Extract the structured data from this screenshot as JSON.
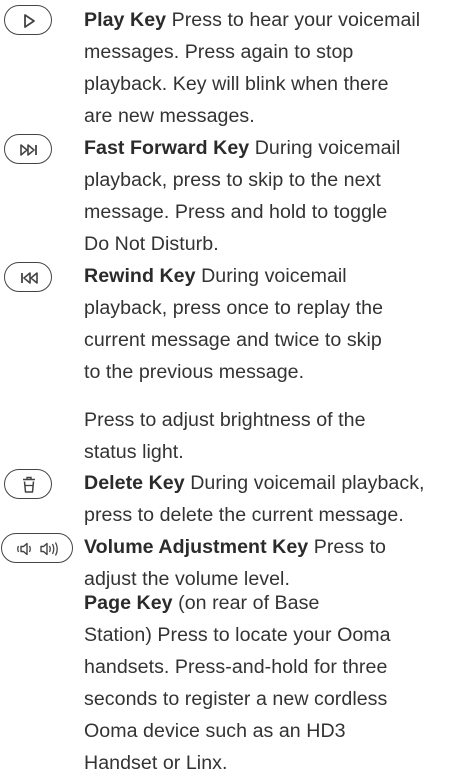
{
  "entries": [
    {
      "icon": "play-icon",
      "title": "Play Key",
      "lines": [
        "Press to hear your voicemail",
        "messages. Press again to stop",
        "playback. Key will blink when there",
        "are new messages."
      ]
    },
    {
      "icon": "fast-forward-icon",
      "title": "Fast Forward Key",
      "lines": [
        "During voicemail",
        "playback, press to skip to the next",
        "message. Press and hold to toggle",
        "Do Not Disturb."
      ]
    },
    {
      "icon": "rewind-icon",
      "title": "Rewind Key",
      "lines": [
        "During voicemail",
        "playback, press once to replay the",
        "current message and twice to skip",
        "to the previous message."
      ]
    },
    {
      "icon": "",
      "title": "",
      "lines": [
        "Press to adjust brightness of the",
        "status light."
      ]
    },
    {
      "icon": "delete-icon",
      "title": "Delete Key",
      "lines": [
        "During voicemail playback,",
        "press to delete the current message."
      ]
    },
    {
      "icon": "volume-icon",
      "title": "Volume Adjustment Key",
      "lines": [
        "Press to",
        "adjust the volume level."
      ]
    },
    {
      "icon": "",
      "title": "Page Key",
      "lines": [
        "(on rear of Base",
        "Station) Press to locate your Ooma",
        "handsets. Press-and-hold for three",
        "seconds to register a new cordless",
        "Ooma device such as an HD3",
        "Handset or Linx."
      ]
    }
  ]
}
